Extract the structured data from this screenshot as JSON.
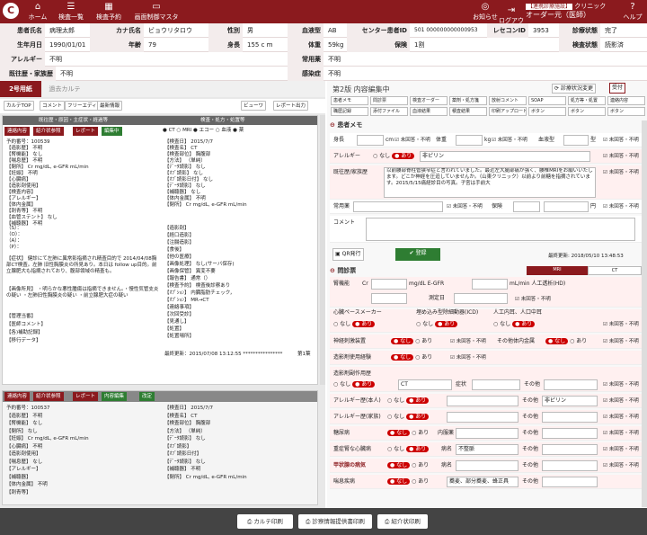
{
  "nav": [
    "ホーム",
    "検査一覧",
    "検査予約",
    "画面制御マスタ"
  ],
  "logo": "C",
  "header_right": {
    "notice": "お知らせ",
    "logout": "ログアウト",
    "help": "ヘルプ",
    "clinic_badge": "【連携診療施設】",
    "clinic_name": "クリニック",
    "user": "オーダー元（医師）"
  },
  "patient": {
    "r1": [
      [
        "患者氏名",
        "病理太郎"
      ],
      [
        "カナ氏名",
        "ビョウリタロウ"
      ],
      [
        "性別",
        "男"
      ],
      [
        "血液型",
        "AB"
      ],
      [
        "センター患者ID",
        "501 000000000000953"
      ],
      [
        "レセコンID",
        "3953"
      ],
      [
        "診療状態",
        "完了"
      ]
    ],
    "r2": [
      [
        "生年月日",
        "1990/01/01"
      ],
      [
        "年齢",
        "79"
      ],
      [
        "身長",
        "155 c m"
      ],
      [
        "体重",
        "59kg"
      ],
      [
        "保険",
        "1割"
      ],
      [
        "検査状態",
        "読影済"
      ]
    ],
    "r3": [
      [
        "アレルギー",
        "不明"
      ],
      [
        "常用薬",
        "不明"
      ]
    ],
    "r4": [
      [
        "既往歴・家族歴",
        "不明"
      ],
      [
        "感染症",
        "不明"
      ]
    ]
  },
  "left": {
    "tab_active": "2号用紙",
    "tab_other": "過去カルテ",
    "tool": [
      "カルテTOP",
      "コメント",
      "フリーエディタ",
      "最新情報",
      "ビューワ",
      "レポート出力"
    ],
    "head_left": "既往歴・原因・主症状・経過等",
    "head_right": "検査・処方・処置等",
    "btns": [
      "連絡内容",
      "紹介状参照",
      "レポート",
      "編集中"
    ],
    "modality": [
      "CT",
      "MRI",
      "エコー",
      "血液",
      "薬"
    ],
    "left_lines": [
      "予約番号：100539",
      "【造影歴】 不明",
      "【腎機能】 なし",
      "【喘息歴】 不明",
      "【閉所】 Cr mg/dL, e-GFR mL/min",
      "【妊娠】 不明",
      "【心臓病】",
      "【造影剤使用】",
      "【検査内容】",
      "【アレルギー】",
      "【体内金属】",
      "【刺青等】 不明",
      "【血管ステント】 なし",
      "【補聴器】 不明"
    ],
    "right_lines": [
      "【検査日】 2015/7/7",
      "【検査名】 CT",
      "【検査部位】 胸腹部",
      "【方法】 （単純）",
      "【ﾃﾞｰﾀ読影】 なし",
      "【ｵﾌﾞ読影】 なし",
      "【ｵﾌﾞ読影日付】 なし",
      "【ﾃﾞｰﾀ読影】 なし",
      "【補聴器】 なし",
      "【体内金属】 不明",
      "【閉所】 Cr mg/dL, e-GFR mL/min"
    ],
    "soap": [
      "（S）：",
      "（O）：",
      "（A）：",
      "（P）："
    ],
    "summary": "【症状】 健診にて左肺に異常影指摘され精査目的で 2014/04/08胸部CT検査。左肺 旧性胸膜炎の所見あり。本日は follow up目的。前立腺肥大も指摘されており、腹部領域の精査も。",
    "finding": "【画像所見】 ・明らかな悪性腫瘍は指摘できません。・慢性気管支炎の疑い ・左肺旧性胸膜炎の疑い ・前立腺肥大症の疑い",
    "meta": [
      "【管理当番】",
      "【医師コメント】",
      "【各)補助記録】",
      "【移行データ】"
    ],
    "right_meta": [
      "【造影剤】",
      "【経口造影】",
      "【注腸造影】",
      "【食後】",
      "【他の医療】",
      "【画像処理】 なし(サーバ保存)",
      "【画像保管】 異変不要",
      "【報告書】 通常（）",
      "【検査予約】 検査後診察あり",
      "【ｵﾌﾟｼｮﾝ】 内臓脂肪チェック，",
      "【ｵﾌﾟｼｮﾝ】 MR→CT",
      "【連絡事項】",
      "【次回受診】",
      "【見通し】",
      "【処置】",
      "【処置場所】"
    ],
    "updated": "最終更新：2015/07/08 13:12:55 ****************",
    "page": "第1葉",
    "btns2": [
      "連絡内容",
      "紹介状参照",
      "レポート",
      "内容編集",
      "改定"
    ],
    "lower_left": [
      "予約番号：100537",
      "【造影歴】 不明",
      "【腎機能】 なし",
      "【閉所】 なし",
      "【妊娠】 Cr mg/dL, e-GFR mL/min",
      "【心臓病】 不明",
      "【造影剤使用】",
      "【喘息歴】 なし",
      "【アレルギー】",
      "【補聴器】",
      "【体内金属】 不明",
      "【刺青等】"
    ],
    "lower_right": [
      "【検査日】 2015/7/7",
      "【検査名】 CT",
      "【検査部位】 胸腹部",
      "【方法】 （単純）",
      "【ﾃﾞｰﾀ読影】 なし",
      "【ｵﾌﾞ読影】",
      "【ｵﾌﾞ読影日付】",
      "【ﾃﾞｰﾀ読影】 なし",
      "【補聴器】 不明",
      "【閉所】 Cr mg/dL, e-GFR mL/min"
    ]
  },
  "right": {
    "title": "第2版 内容編集中",
    "status_btn": "診療状況変更",
    "accept": "受付",
    "tool_row1": [
      "患者メモ",
      "問診票",
      "検査オーダー",
      "薬剤・処方箋",
      "放射コメント",
      "SOAP",
      "処方等・処置",
      "連絡内容"
    ],
    "tool_row2": [
      "職歴記録",
      "添付ファイル",
      "血液結果",
      "積査結果",
      "印刷アップロード",
      "ボタン",
      "ボタン",
      "ボタン"
    ],
    "memo_title": "患者メモ",
    "height": "身長",
    "cm": "cm",
    "weight": "体重",
    "kg": "kg",
    "blood": "血液型",
    "blood_unit": "型",
    "unknown": "未回答・不明",
    "allergy": "アレルギー",
    "none": "なし",
    "yes": "あり",
    "allergy_val": "非ピリン",
    "history": "既往歴/家族歴",
    "history_text": "以前腰部脊柱管狭窄症と言われていました。最近左大腿部痛が強く、腰椎MRIをお願いいたします。どこか神経を圧迫していませんか。（山東クリニック）以前より前糖を指摘されています。2015/5/15痛経診目の写真。子宮は手前大",
    "meds": "常用薬",
    "insurance": "保険",
    "yen": "円",
    "comment": "コメント",
    "qr": "QR発行",
    "register": "登録",
    "updated": "最終更新: 2018/05/10 13:48:53",
    "q_title": "問診票",
    "mri": "MRI",
    "ct": "CT",
    "renal": "腎機能",
    "cr": "Cr",
    "unit1": "mg/dL E-GFR",
    "unit2": "mL/min 人工透析(HD)",
    "test_date": "測定日",
    "pacemaker": "心臓ペースメーカー",
    "icd": "埋め込み型除細動器(ICD)",
    "ear": "人工内耳、人口中耳",
    "nerve": "神経刺激装置",
    "other_metal": "その他体内金属",
    "contrast": "造影剤使用経験",
    "side": "造影剤副作用歴",
    "ct_sel": "CT",
    "symptom": "症状",
    "other": "その他",
    "allergy_self": "アレルギー歴(本人)",
    "allergy_fam": "アレルギー歴(家族)",
    "diabetes": "糖尿病",
    "internal": "内服薬",
    "kidney": "重症腎な心臓病",
    "disease": "病名",
    "disease_val": "不整脈",
    "thyroid": "甲状腺の病気",
    "asthma": "喘息疾病",
    "asthma_val": "蕎麦、部分蕎麦、蜂正具",
    "print": [
      "カルテ印刷",
      "診察情報提供書印刷",
      "紹介状印刷"
    ]
  }
}
